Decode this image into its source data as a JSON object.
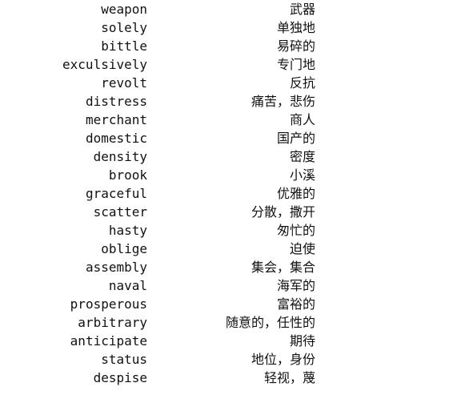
{
  "vocabulary": [
    {
      "english": "weapon",
      "chinese": "武器"
    },
    {
      "english": "solely",
      "chinese": "单独地"
    },
    {
      "english": "bittle",
      "chinese": "易碎的"
    },
    {
      "english": "exculsively",
      "chinese": "专门地"
    },
    {
      "english": "revolt",
      "chinese": "反抗"
    },
    {
      "english": "distress",
      "chinese": "痛苦，悲伤"
    },
    {
      "english": "merchant",
      "chinese": "商人"
    },
    {
      "english": "domestic",
      "chinese": "国产的"
    },
    {
      "english": "density",
      "chinese": "密度"
    },
    {
      "english": "brook",
      "chinese": "小溪"
    },
    {
      "english": "graceful",
      "chinese": "优雅的"
    },
    {
      "english": "scatter",
      "chinese": "分散，撒开"
    },
    {
      "english": "hasty",
      "chinese": "匆忙的"
    },
    {
      "english": "oblige",
      "chinese": "迫使"
    },
    {
      "english": "assembly",
      "chinese": "集会，集合"
    },
    {
      "english": "naval",
      "chinese": "海军的"
    },
    {
      "english": "prosperous",
      "chinese": "富裕的"
    },
    {
      "english": "arbitrary",
      "chinese": "随意的，任性的"
    },
    {
      "english": "anticipate",
      "chinese": "期待"
    },
    {
      "english": "status",
      "chinese": "地位，身份"
    },
    {
      "english": "despise",
      "chinese": "轻视，蔑"
    }
  ]
}
